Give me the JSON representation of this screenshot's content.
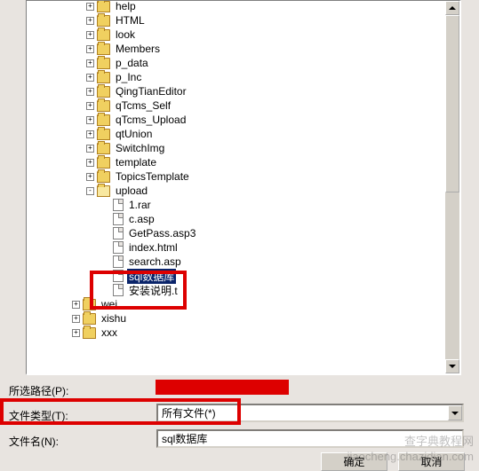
{
  "tree": {
    "folders": [
      {
        "label": "help",
        "indent": 64
      },
      {
        "label": "HTML",
        "indent": 64
      },
      {
        "label": "look",
        "indent": 64
      },
      {
        "label": "Members",
        "indent": 64
      },
      {
        "label": "p_data",
        "indent": 64
      },
      {
        "label": "p_Inc",
        "indent": 64
      },
      {
        "label": "QingTianEditor",
        "indent": 64
      },
      {
        "label": "qTcms_Self",
        "indent": 64
      },
      {
        "label": "qTcms_Upload",
        "indent": 64
      },
      {
        "label": "qtUnion",
        "indent": 64
      },
      {
        "label": "SwitchImg",
        "indent": 64
      },
      {
        "label": "template",
        "indent": 64
      },
      {
        "label": "TopicsTemplate",
        "indent": 64
      }
    ],
    "upload_label": "upload",
    "files": [
      {
        "label": "1.rar"
      },
      {
        "label": "c.asp"
      },
      {
        "label": "GetPass.asp3"
      },
      {
        "label": "index.html"
      },
      {
        "label": "search.asp"
      },
      {
        "label": "sql数据库",
        "selected": true
      },
      {
        "label": "安装说明.t"
      }
    ],
    "tail_folders": [
      {
        "label": "wei",
        "indent": 48
      },
      {
        "label": "xishu",
        "indent": 48
      },
      {
        "label": "xxx",
        "indent": 48
      }
    ]
  },
  "labels": {
    "path": "所选路径(P):",
    "type": "文件类型(T):",
    "name": "文件名(N):"
  },
  "fields": {
    "type_value": "所有文件(*)",
    "name_value": "sql数据库"
  },
  "buttons": {
    "ok": "确定",
    "cancel": "取消"
  },
  "watermark": {
    "line1": "查字典教程网",
    "line2": "jiaocheng.chazidian.com"
  },
  "colors": {
    "highlight_border": "#d00",
    "selection": "#0a246a"
  }
}
